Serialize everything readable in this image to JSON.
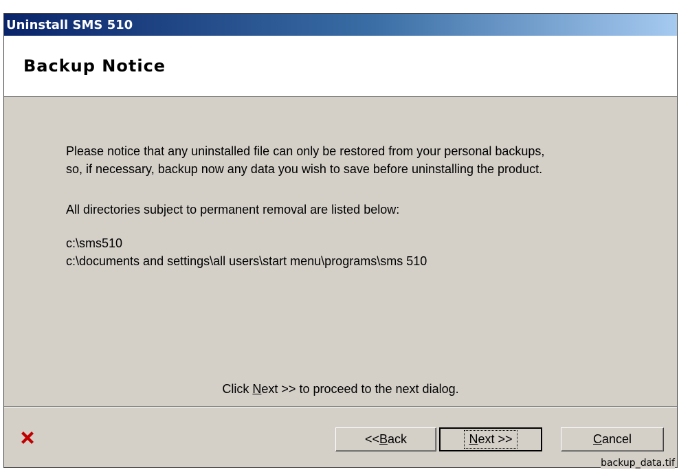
{
  "window": {
    "title": "Uninstall SMS 510"
  },
  "header": {
    "heading": "Backup Notice"
  },
  "content": {
    "paragraph_line1": "Please notice that any uninstalled file can only be restored from your personal backups,",
    "paragraph_line2": "so, if necessary, backup now any data you wish to save before uninstalling the product.",
    "directories_intro": "All directories subject to permanent removal are listed below:",
    "directories": [
      "c:\\sms510",
      "c:\\documents and settings\\all users\\start menu\\programs\\sms 510"
    ],
    "proceed_prefix": "Click ",
    "proceed_link_mnemonic": "N",
    "proceed_link_rest": "ext >>",
    "proceed_suffix": " to proceed to the next dialog."
  },
  "buttons": {
    "back_prefix": "<< ",
    "back_mnemonic": "B",
    "back_rest": "ack",
    "next_mnemonic": "N",
    "next_rest": "ext >>",
    "cancel_mnemonic": "C",
    "cancel_rest": "ancel"
  },
  "icons": {
    "cancel_mark": "close-icon"
  },
  "colors": {
    "dialog_bg": "#d4d0c8",
    "title_gradient_start": "#0a246a",
    "title_gradient_end": "#a6caf0",
    "x_mark": "#c00000"
  },
  "caption": {
    "filename": "backup_data.tif"
  }
}
